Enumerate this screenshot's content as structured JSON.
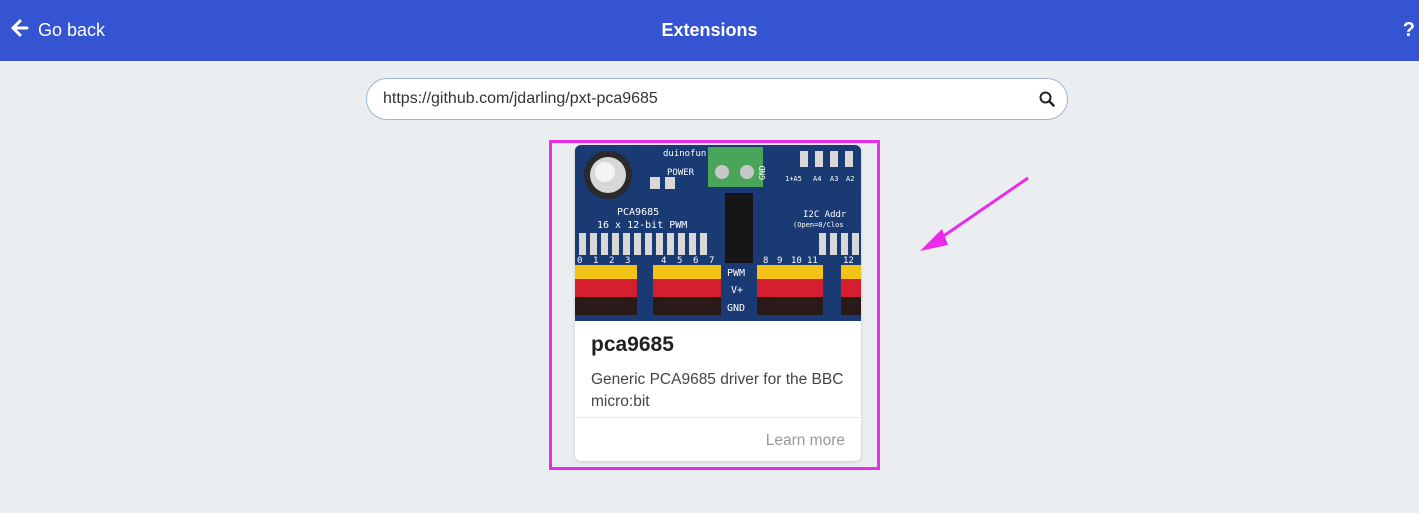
{
  "header": {
    "back_label": "Go back",
    "title": "Extensions",
    "help_label": "?"
  },
  "search": {
    "value": "https://github.com/jdarling/pxt-pca9685"
  },
  "card": {
    "title": "pca9685",
    "description": "Generic PCA9685 driver for the BBC micro:bit",
    "learn_more": "Learn more",
    "image_labels": {
      "brand": "duinofun",
      "power": "POWER",
      "chip": "PCA9685",
      "pwm_spec": "16 x 12-bit PWM",
      "addr": "I2C Addr",
      "addr_sub": "(Open=0/Clos",
      "addr_pins": [
        "1+A5",
        "A4",
        "A3",
        "A2"
      ],
      "gnd_top": "GND",
      "pwm": "PWM",
      "vplus": "V+",
      "gnd": "GND",
      "pins_left": [
        "0",
        "1",
        "2",
        "3"
      ],
      "pins_mid": [
        "4",
        "5",
        "6",
        "7"
      ],
      "pins_right": [
        "8",
        "9",
        "10",
        "11"
      ],
      "pins_far": [
        "12"
      ]
    }
  },
  "colors": {
    "header_bg": "#3454d1",
    "page_bg": "#eaeef0",
    "highlight": "#ea2bea"
  }
}
